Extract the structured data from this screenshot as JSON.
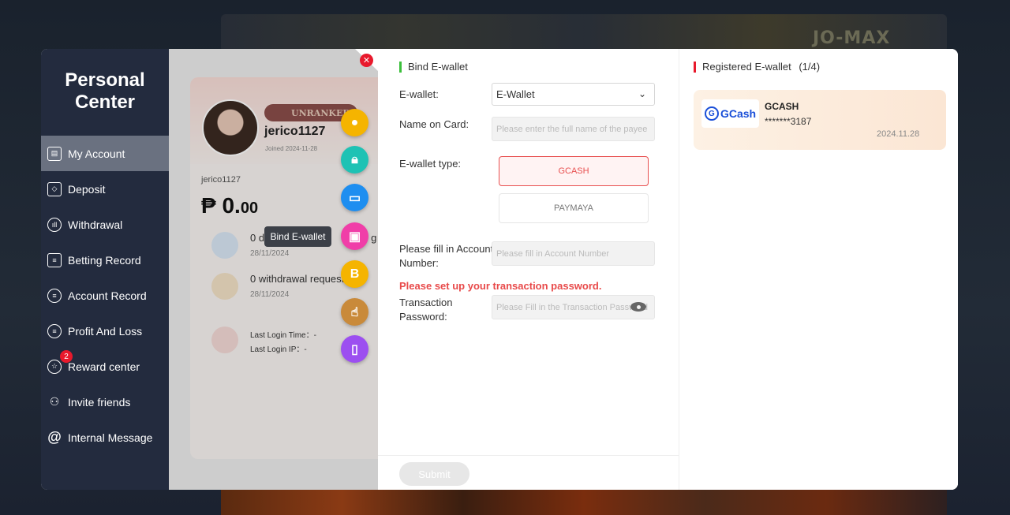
{
  "background": {
    "brand": "JO-MAX"
  },
  "sidebar": {
    "title_line1": "Personal",
    "title_line2": "Center",
    "items": [
      {
        "label": "My Account",
        "icon": "account-icon"
      },
      {
        "label": "Deposit",
        "icon": "deposit-icon"
      },
      {
        "label": "Withdrawal",
        "icon": "withdrawal-icon"
      },
      {
        "label": "Betting Record",
        "icon": "betting-record-icon"
      },
      {
        "label": "Account Record",
        "icon": "account-record-icon"
      },
      {
        "label": "Profit And Loss",
        "icon": "profit-loss-icon"
      },
      {
        "label": "Reward center",
        "icon": "reward-icon",
        "badge": "2"
      },
      {
        "label": "Invite friends",
        "icon": "invite-icon"
      },
      {
        "label": "Internal Message",
        "icon": "at-icon"
      }
    ]
  },
  "profile": {
    "rank": "UNRANKED",
    "username": "jerico1127",
    "joined": "Joined 2024-11-28",
    "uid": "jerico1127",
    "currency": "₱",
    "balance_int": "0.",
    "balance_dec": "00",
    "row1_text": "0 d",
    "row1_text_suffix": "g",
    "row1_date": "28/11/2024",
    "row2_text": "0 withdrawal requests",
    "row2_date": "28/11/2024",
    "last_login_time": "Last Login Time：-",
    "last_login_ip": "Last Login IP：-"
  },
  "tooltip": "Bind E-wallet",
  "form": {
    "section_title": "Bind E-wallet",
    "ewallet_label": "E-wallet:",
    "ewallet_value": "E-Wallet",
    "name_label": "Name on Card:",
    "name_placeholder": "Please enter the full name of the payee",
    "type_label": "E-wallet type:",
    "type_options": [
      "GCASH",
      "PAYMAYA"
    ],
    "account_label_line1": "Please fill in Account",
    "account_label_line2": "Number:",
    "account_placeholder": "Please fill in Account Number",
    "warning": "Please set up your transaction password.",
    "txpw_label_line1": "Transaction",
    "txpw_label_line2": "Password:",
    "txpw_placeholder": "Please Fill in the Transaction Password",
    "submit": "Submit"
  },
  "registered": {
    "title": "Registered E-wallet",
    "count": "(1/4)",
    "card": {
      "logo_text": "GCash",
      "name": "GCASH",
      "number": "*******3187",
      "date": "2024.11.28"
    }
  },
  "colors": {
    "sidebar_bg": "#232b3e",
    "accent_red": "#e8192c",
    "accent_green": "#3bbf3b"
  }
}
